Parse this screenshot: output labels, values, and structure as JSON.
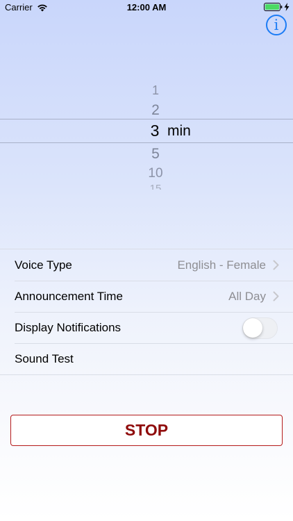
{
  "status_bar": {
    "carrier": "Carrier",
    "time": "12:00 AM",
    "wifi_icon": "wifi-icon",
    "battery_icon": "battery-full-icon",
    "charging_icon": "charging-bolt-icon"
  },
  "header": {
    "info_button_label": "i",
    "info_icon": "info-icon",
    "accent_color": "#1c7cf5"
  },
  "picker": {
    "options": [
      "1",
      "2",
      "3",
      "5",
      "10",
      "15"
    ],
    "selected": "3",
    "unit": "min"
  },
  "settings": {
    "voice_type": {
      "label": "Voice Type",
      "value": "English - Female"
    },
    "announcement_time": {
      "label": "Announcement Time",
      "value": "All Day"
    },
    "display_notifications": {
      "label": "Display Notifications",
      "enabled": false
    },
    "sound_test": {
      "label": "Sound Test"
    }
  },
  "stop_button": {
    "label": "STOP",
    "color": "#8f0b0b"
  }
}
